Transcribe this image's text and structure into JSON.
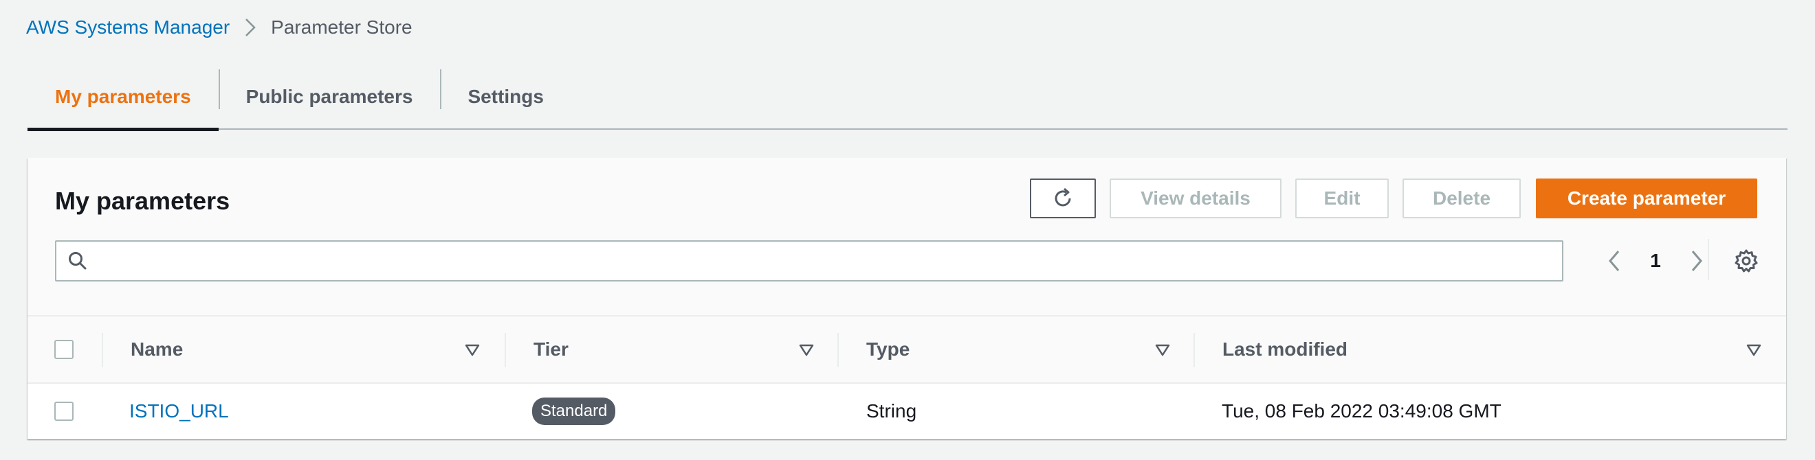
{
  "breadcrumb": {
    "service": "AWS Systems Manager",
    "current": "Parameter Store"
  },
  "tabs": [
    {
      "label": "My parameters",
      "active": true
    },
    {
      "label": "Public parameters",
      "active": false
    },
    {
      "label": "Settings",
      "active": false
    }
  ],
  "panel": {
    "title": "My parameters",
    "buttons": {
      "view_details": "View details",
      "edit": "Edit",
      "delete": "Delete",
      "create": "Create parameter"
    },
    "search": {
      "value": "",
      "placeholder": ""
    },
    "pagination": {
      "current_page": "1"
    }
  },
  "table": {
    "columns": [
      "Name",
      "Tier",
      "Type",
      "Last modified"
    ],
    "rows": [
      {
        "name": "ISTIO_URL",
        "tier": "Standard",
        "type": "String",
        "last_modified": "Tue, 08 Feb 2022 03:49:08 GMT",
        "selected": false
      }
    ]
  },
  "colors": {
    "accent": "#ec7211",
    "link": "#0073bb",
    "text": "#16191f",
    "muted": "#545b64",
    "disabled": "#aab7b8",
    "background": "#f2f3f3"
  },
  "icons": [
    "chevron-right-icon",
    "refresh-icon",
    "search-icon",
    "chevron-left-icon",
    "chevron-right-icon",
    "gear-icon",
    "sort-caret-icon"
  ]
}
